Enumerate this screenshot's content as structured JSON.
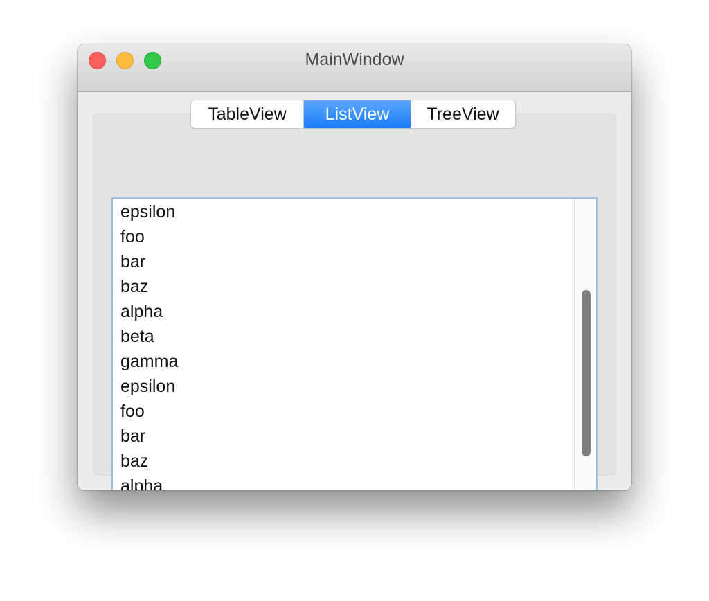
{
  "window": {
    "title": "MainWindow"
  },
  "tabs": [
    {
      "label": "TableView",
      "selected": false
    },
    {
      "label": "ListView",
      "selected": true
    },
    {
      "label": "TreeView",
      "selected": false
    }
  ],
  "list": {
    "items": [
      "epsilon",
      "foo",
      "bar",
      "baz",
      "alpha",
      "beta",
      "gamma",
      "epsilon",
      "foo",
      "bar",
      "baz",
      "alpha"
    ],
    "scroll": {
      "thumb_start_fraction": 0.3,
      "thumb_size_fraction": 0.55
    }
  },
  "colors": {
    "accent": "#1a7cf6",
    "close": "#fc605c",
    "minimize": "#fdbc40",
    "zoom": "#34c84a",
    "focus_ring": "#9fc0e6"
  }
}
